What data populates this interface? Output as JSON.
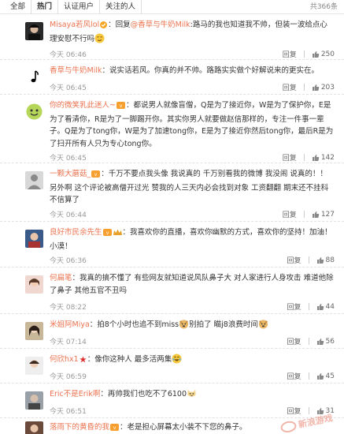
{
  "tabs": [
    "全部",
    "热门",
    "认证用户",
    "关注的人"
  ],
  "total": "共366条",
  "reply_label": "回复",
  "comments": [
    {
      "user": "Misaya若风lol",
      "badge": "verified",
      "body": "：回复",
      "mention": "@香草与牛奶Milk",
      "rest": ":路马的我也知道我不帅，但装一波给点心理安慰不行吗",
      "emoji": "smirk",
      "time": "今天 06:46",
      "likes": "250"
    },
    {
      "user": "香草与牛奶Milk",
      "badge": "",
      "body": "：说实话若风。你真的并不帅。路路实实做个好解说来的更实在。",
      "mention": "",
      "rest": "",
      "emoji": "",
      "time": "今天 06:45",
      "likes": "203"
    },
    {
      "user": "你的微笑乳此迷人~",
      "badge": "vip",
      "body": "：都说男人就像盲僧，Q是为了接近你，W是为了保护你，E是为了看清你，R是为了一脚踢开你。其实你男人就要做赵信那样的，专注一件事一辈子。Q是为了tong你，W是为了加速tong你，E是为了接近你然后tong你，最后R是为了扫开所有人只为专心tong你。",
      "mention": "",
      "rest": "",
      "emoji": "",
      "time": "今天 06:45",
      "likes": "142"
    },
    {
      "user": "一颗大蘑菇_",
      "badge": "vip",
      "body": "：千万不要点我头像  我说真的  千万别看我的微博  我没闹  说真的！！另外啊  这个评论被高僧开过光  赞我的人三天内必会找到对象  工资翻翻  期末还不挂科  不信算了",
      "mention": "",
      "rest": "",
      "emoji": "",
      "time": "今天 06:44",
      "likes": "127"
    },
    {
      "user": "良好市民余先生",
      "badge": "vip",
      "body": "：我喜欢你的直播，喜欢你幽默的方式，喜欢你的坚持！加油！小漠！",
      "mention": "",
      "rest": "",
      "emoji": "",
      "time": "今天 06:36",
      "likes": "88"
    },
    {
      "user": "何扁笔",
      "badge": "",
      "body": "：我真的搞不懂了 有些网友就知道说风队鼻子大 对人家进行人身攻击 难道他除了鼻子 其他五官不丑吗",
      "mention": "",
      "rest": "",
      "emoji": "",
      "time": "今天 08:22",
      "likes": "44"
    },
    {
      "user": "米姐阿Miya",
      "badge": "",
      "body": "：拍8个小时也追不到miss",
      "mention": "",
      "rest": "别拍了 瞄j8浪费时间",
      "emoji": "doge",
      "time": "今天 07:14",
      "likes": "56"
    },
    {
      "user": "何欣hx1",
      "badge": "star",
      "body": "：像你这种人 最多活两集",
      "mention": "",
      "rest": "",
      "emoji": "laugh",
      "time": "今天 06:59",
      "likes": "45"
    },
    {
      "user": "Eric不是Erik啊",
      "badge": "",
      "body": "：再帅我们也吃不了6100",
      "mention": "",
      "rest": "",
      "emoji": "cat",
      "time": "今天 06:51",
      "likes": "31"
    },
    {
      "user": "落雨下的黄昏的我",
      "badge": "vip",
      "body": "：老是担心屏幕太小装不下您的鼻子。",
      "mention": "",
      "rest": "",
      "emoji": "",
      "time": "",
      "likes": ""
    }
  ],
  "watermark": "新浪游戏",
  "colors": {
    "link": "#eb7350",
    "meta": "#999999",
    "border": "#e2e2e2"
  }
}
